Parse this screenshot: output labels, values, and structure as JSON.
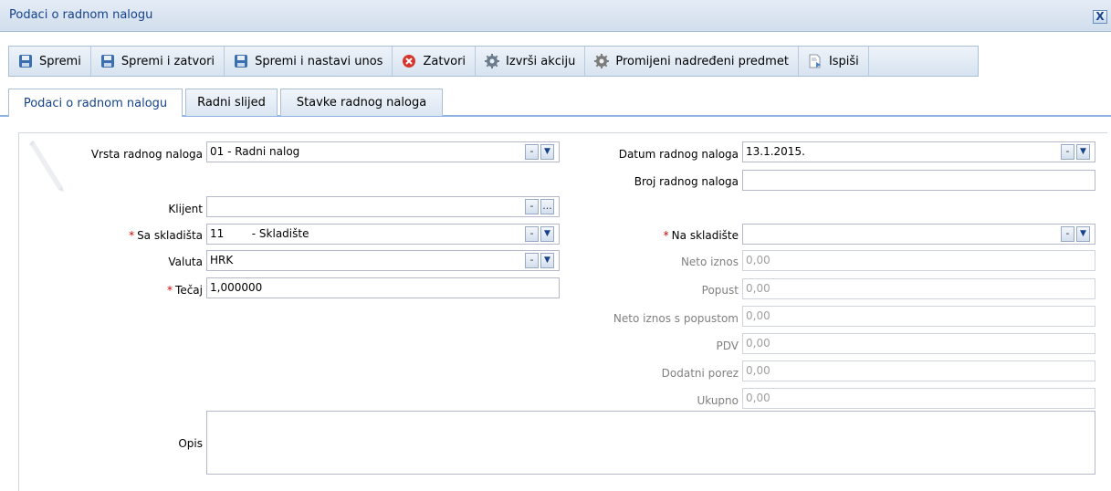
{
  "window": {
    "title": "Podaci o radnom nalogu",
    "close_glyph": "X"
  },
  "toolbar": {
    "buttons": [
      {
        "label": "Spremi",
        "icon": "floppy-disk-icon"
      },
      {
        "label": "Spremi i zatvori",
        "icon": "floppy-disk-icon"
      },
      {
        "label": "Spremi i nastavi unos",
        "icon": "floppy-disk-icon"
      },
      {
        "label": "Zatvori",
        "icon": "close-circle-icon"
      },
      {
        "label": "Izvrši akciju",
        "icon": "gear-icon"
      },
      {
        "label": "Promijeni nadređeni predmet",
        "icon": "gear-icon"
      },
      {
        "label": "Ispiši",
        "icon": "print-document-icon"
      }
    ]
  },
  "tabs": [
    {
      "label": "Podaci o radnom nalogu",
      "active": true
    },
    {
      "label": "Radni slijed",
      "active": false
    },
    {
      "label": "Stavke radnog naloga",
      "active": false
    }
  ],
  "form": {
    "vrsta": {
      "label": "Vrsta radnog naloga",
      "value": "01 - Radni nalog"
    },
    "klijent": {
      "label": "Klijent",
      "value": ""
    },
    "sa_skladista": {
      "label": "Sa skladišta",
      "value": "11        - Skladište",
      "required": true
    },
    "valuta": {
      "label": "Valuta",
      "value": "HRK"
    },
    "tecaj": {
      "label": "Tečaj",
      "value": "1,000000",
      "required": true
    },
    "opis": {
      "label": "Opis",
      "value": ""
    },
    "datum": {
      "label": "Datum radnog naloga",
      "value": "13.1.2015."
    },
    "broj": {
      "label": "Broj radnog naloga",
      "value": ""
    },
    "na_skladiste": {
      "label": "Na skladište",
      "value": "",
      "required": true
    },
    "neto_iznos": {
      "label": "Neto iznos",
      "value": "0,00"
    },
    "popust": {
      "label": "Popust",
      "value": "0,00"
    },
    "neto_popust": {
      "label": "Neto iznos s popustom",
      "value": "0,00"
    },
    "pdv": {
      "label": "PDV",
      "value": "0,00"
    },
    "dodatni_porez": {
      "label": "Dodatni porez",
      "value": "0,00"
    },
    "ukupno": {
      "label": "Ukupno",
      "value": "0,00"
    }
  },
  "controls": {
    "clear_glyph": "-",
    "dropdown_glyph": "▼",
    "browse_glyph": "...",
    "required_mark": "*"
  },
  "colors": {
    "accent": "#15428b",
    "required": "#d40000",
    "border": "#a9bfd6"
  }
}
